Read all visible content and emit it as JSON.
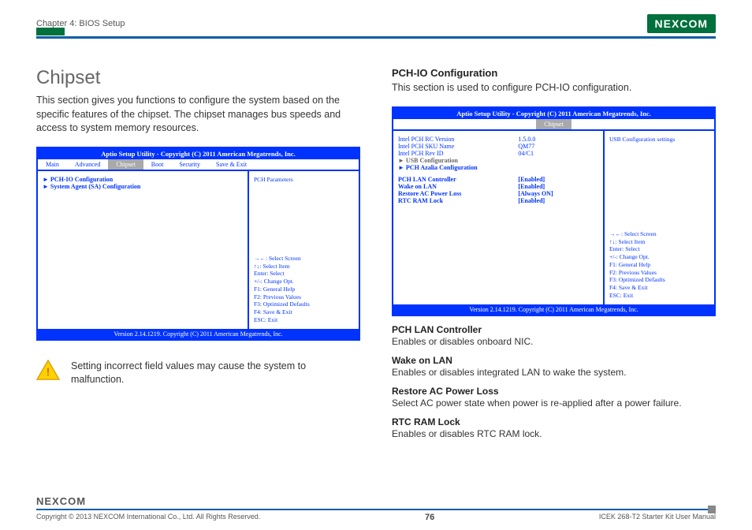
{
  "header": {
    "chapter": "Chapter 4: BIOS Setup",
    "logo": "NEXCOM"
  },
  "left": {
    "title": "Chipset",
    "intro": "This section gives you functions to configure the system based on the specific features of the chipset. The chipset manages bus speeds and access to system memory resources.",
    "bios": {
      "title": "Aptio Setup Utility - Copyright (C) 2011 American Megatrends, Inc.",
      "tabs": [
        "Main",
        "Advanced",
        "Chipset",
        "Boot",
        "Security",
        "Save & Exit"
      ],
      "active_tab": "Chipset",
      "items": [
        "PCH-IO Configuration",
        "System Agent (SA) Configuration"
      ],
      "help_top": "PCH Parameters",
      "help_keys": "→←: Select Screen\n↑↓: Select Item\nEnter: Select\n+/-: Change Opt.\nF1: General Help\nF2: Previous Values\nF3: Optimized Defaults\nF4: Save & Exit\nESC: Exit",
      "footer": "Version 2.14.1219. Copyright (C) 2011 American Megatrends, Inc."
    },
    "warning": "Setting incorrect field values may cause the system to malfunction."
  },
  "right": {
    "title": "PCH-IO Configuration",
    "intro": "This section is used to configure PCH-IO configuration.",
    "bios": {
      "title": "Aptio Setup Utility - Copyright (C) 2011 American Megatrends, Inc.",
      "tabs_single": "Chipset",
      "info": [
        {
          "lbl": "Intel PCH RC Version",
          "val": "1.5.0.0"
        },
        {
          "lbl": "Intel PCH SKU Name",
          "val": "QM77"
        },
        {
          "lbl": "Intel PCH Rev ID",
          "val": "04/C1"
        }
      ],
      "links": [
        "USB Configuration",
        "PCH Azalia Configuration"
      ],
      "settings": [
        {
          "lbl": "PCH LAN Controller",
          "val": "[Enabled]"
        },
        {
          "lbl": "   Wake on LAN",
          "val": "[Enabled]"
        },
        {
          "lbl": "",
          "val": ""
        },
        {
          "lbl": "Restore AC Power Loss",
          "val": "[Always ON]"
        },
        {
          "lbl": "RTC RAM Lock",
          "val": "[Enabled]"
        }
      ],
      "help_top": "USB Configuration settings",
      "help_keys": "→←: Select Screen\n↑↓: Select Item\nEnter: Select\n+/-: Change Opt.\nF1: General Help\nF2: Previous Values\nF3: Optimized Defaults\nF4: Save & Exit\nESC: Exit",
      "footer": "Version 2.14.1219. Copyright (C) 2011 American Megatrends, Inc."
    },
    "options": [
      {
        "h": "PCH LAN Controller",
        "d": "Enables or disables onboard NIC."
      },
      {
        "h": "Wake on LAN",
        "d": "Enables or disables integrated LAN to wake the system."
      },
      {
        "h": "Restore AC Power Loss",
        "d": "Select AC power state when power is re-applied after a power failure."
      },
      {
        "h": "RTC RAM Lock",
        "d": "Enables or disables RTC RAM lock."
      }
    ]
  },
  "footer": {
    "logo": "NEXCOM",
    "copyright": "Copyright © 2013 NEXCOM International Co., Ltd. All Rights Reserved.",
    "page": "76",
    "doc": "ICEK 268-T2 Starter Kit User Manual"
  }
}
